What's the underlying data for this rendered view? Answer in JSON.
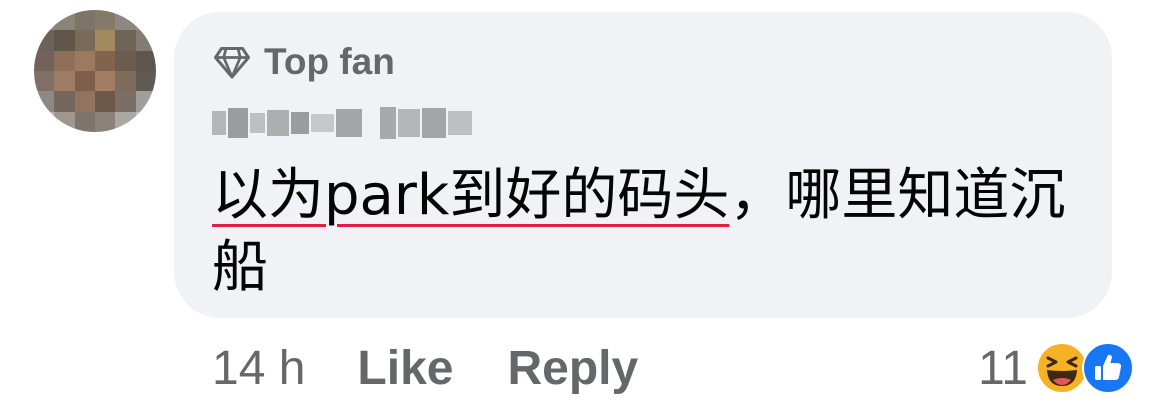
{
  "comment": {
    "badge_label": "Top fan",
    "text_underlined": "以为park到好的码头",
    "text_rest": "，哪里知道沉船",
    "time": "14 h",
    "like_label": "Like",
    "reply_label": "Reply",
    "reaction_count": "11",
    "reactions": [
      "haha-icon",
      "like-reaction-icon"
    ]
  },
  "colors": {
    "bubble": "#f0f2f5",
    "secondary_text": "#65676b",
    "primary_text": "#050505",
    "underline": "#e41e3f",
    "like_blue": "#1877f2",
    "haha_yellow": "#f7b125"
  }
}
